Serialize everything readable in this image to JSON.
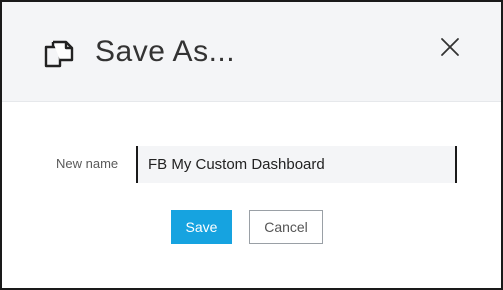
{
  "dialog": {
    "title": "Save As...",
    "header_icon": "copy-documents-icon",
    "close_icon": "close-icon"
  },
  "form": {
    "name_label": "New name",
    "name_value": "FB My Custom Dashboard"
  },
  "buttons": {
    "save_label": "Save",
    "cancel_label": "Cancel"
  },
  "colors": {
    "accent": "#16a3e0",
    "header_bg": "#f4f5f7",
    "input_bg": "#f4f5f7"
  }
}
